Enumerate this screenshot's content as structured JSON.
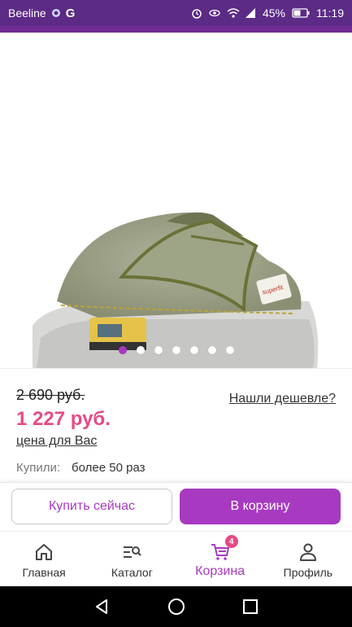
{
  "status_bar": {
    "carrier": "Beeline",
    "carrier_badge": "G",
    "battery_percent": "45%",
    "time": "11:19",
    "icons": [
      "alarm-icon",
      "eye-icon",
      "wifi-icon",
      "signal-icon",
      "battery-icon"
    ]
  },
  "gallery": {
    "image_subject": "shoe-photo",
    "page_count": 7,
    "active_page": 1
  },
  "price": {
    "old_price": "2 690 руб.",
    "new_price": "1 227 руб.",
    "price_for_you_label": "цена для Вас",
    "found_cheaper_label": "Нашли дешевле?",
    "bought_label": "Купили:",
    "bought_value": "более 50 раз"
  },
  "actions": {
    "buy_now_label": "Купить сейчас",
    "add_to_cart_label": "В корзину"
  },
  "bottom_nav": {
    "items": [
      {
        "label": "Главная",
        "icon": "home-icon",
        "active": false
      },
      {
        "label": "Каталог",
        "icon": "catalog-search-icon",
        "active": false
      },
      {
        "label": "Корзина",
        "icon": "cart-icon",
        "active": true,
        "badge": "4"
      },
      {
        "label": "Профиль",
        "icon": "profile-icon",
        "active": false
      }
    ]
  },
  "colors": {
    "accent": "#a73ac0",
    "price": "#e64a87",
    "status_bar": "#5b2b86"
  }
}
